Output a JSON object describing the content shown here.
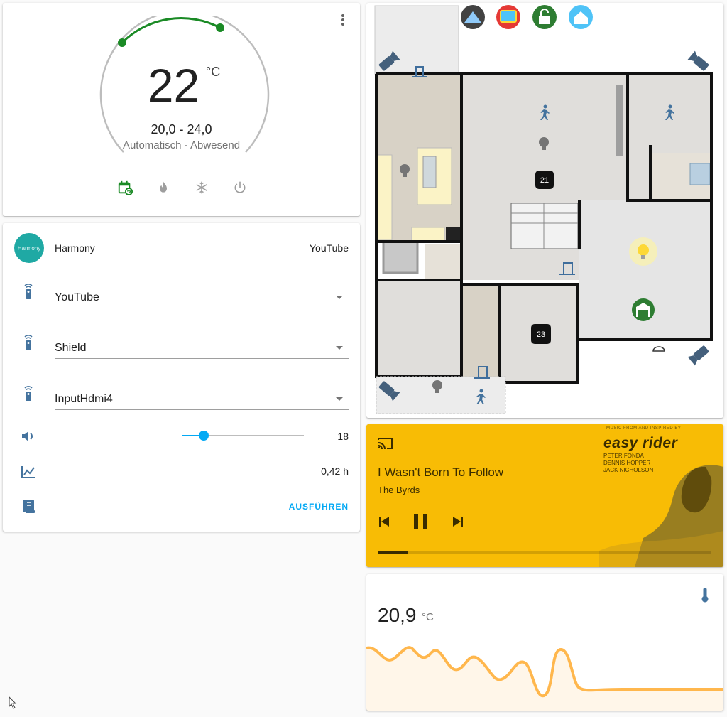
{
  "thermostat": {
    "current_temp": "22",
    "unit": "°C",
    "range": "20,0 - 24,0",
    "mode_label": "Automatisch - Abwesend",
    "colors": {
      "arc": "#1a8a25",
      "track": "#bdbdbd",
      "active_mode": "#1a8a25",
      "inactive_mode": "#9e9e9e"
    },
    "modes": [
      {
        "icon": "calendar-sync-icon",
        "active": true
      },
      {
        "icon": "fire-icon",
        "active": false
      },
      {
        "icon": "snowflake-icon",
        "active": false
      },
      {
        "icon": "power-icon",
        "active": false
      }
    ]
  },
  "harmony": {
    "avatar_text": "Harmony",
    "name": "Harmony",
    "state": "YouTube",
    "selects": [
      {
        "icon": "remote-icon",
        "value": "YouTube"
      },
      {
        "icon": "remote-icon",
        "value": "Shield"
      },
      {
        "icon": "remote-icon",
        "value": "InputHdmi4"
      }
    ],
    "volume": {
      "icon": "volume-icon",
      "value": "18",
      "fraction": 0.18
    },
    "usage": {
      "icon": "chart-line-icon",
      "value": "0,42 h"
    },
    "script": {
      "icon": "script-icon",
      "action_label": "AUSFÜHREN"
    },
    "accent": "#03a9f4"
  },
  "floorplan": {
    "top_icons": [
      "router-icon",
      "tv-icon",
      "lock-icon",
      "home-icon"
    ],
    "badges": [
      "21",
      "23"
    ]
  },
  "media": {
    "song": "I Wasn't Born To Follow",
    "artist": "The Byrds",
    "progress": 0.09,
    "background": "#f8bc05",
    "poster_tag": "MUSIC FROM AND INSPIRED BY",
    "poster_title": "easy rider",
    "poster_cast": [
      "PETER FONDA",
      "DENNIS HOPPER",
      "JACK NICHOLSON"
    ]
  },
  "sensor": {
    "icon": "thermometer-icon",
    "value": "20,9",
    "unit": "°C",
    "graph_color": "#ffb74d"
  }
}
